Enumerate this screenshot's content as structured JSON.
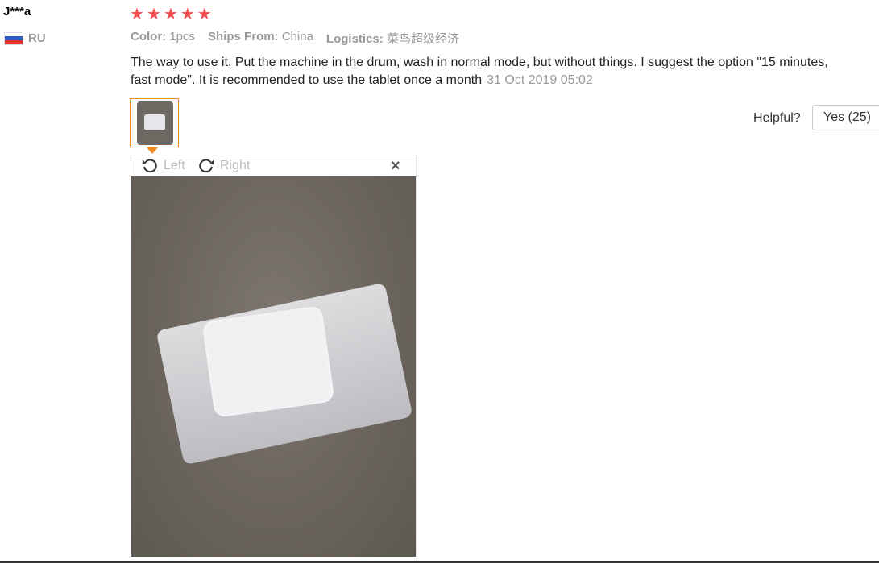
{
  "reviewer": {
    "name": "J***a",
    "country_code": "RU",
    "flag_colors": [
      "#ffffff",
      "#2c5cc5",
      "#e0322f"
    ]
  },
  "rating": {
    "stars": 5,
    "max": 5,
    "star_color": "#f44e4e"
  },
  "attributes": [
    {
      "key": "Color:",
      "value": "1pcs"
    },
    {
      "key": "Ships From:",
      "value": "China"
    },
    {
      "key": "Logistics:",
      "value": "菜鸟超级经济"
    }
  ],
  "review": {
    "text": "The way to use it. Put the machine in the drum, wash in normal mode, but without things. I suggest the option \"15 minutes, fast mode\". It is recommended to use the tablet once a month",
    "date": "31 Oct 2019 05:02"
  },
  "viewer": {
    "rotate_left_label": "Left",
    "rotate_right_label": "Right",
    "close_symbol": "×",
    "accent_color": "#f08a24"
  },
  "helpful": {
    "label": "Helpful?",
    "yes_button": "Yes (25)"
  }
}
